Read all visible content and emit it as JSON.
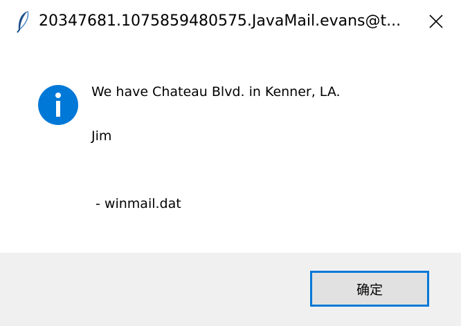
{
  "window": {
    "title": "20347681.1075859480575.JavaMail.evans@t...",
    "title_icon": "feather-icon",
    "close_icon": "close-icon"
  },
  "message": {
    "icon": "info-icon",
    "lines": [
      "We have Chateau Blvd. in Kenner, LA.",
      "Jim",
      " - winmail.dat"
    ]
  },
  "buttons": {
    "ok_label": "确定"
  },
  "colors": {
    "info_blue": "#0078d7",
    "button_border": "#0078d7",
    "footer_bg": "#f0f0f0",
    "button_bg": "#e1e1e1"
  }
}
